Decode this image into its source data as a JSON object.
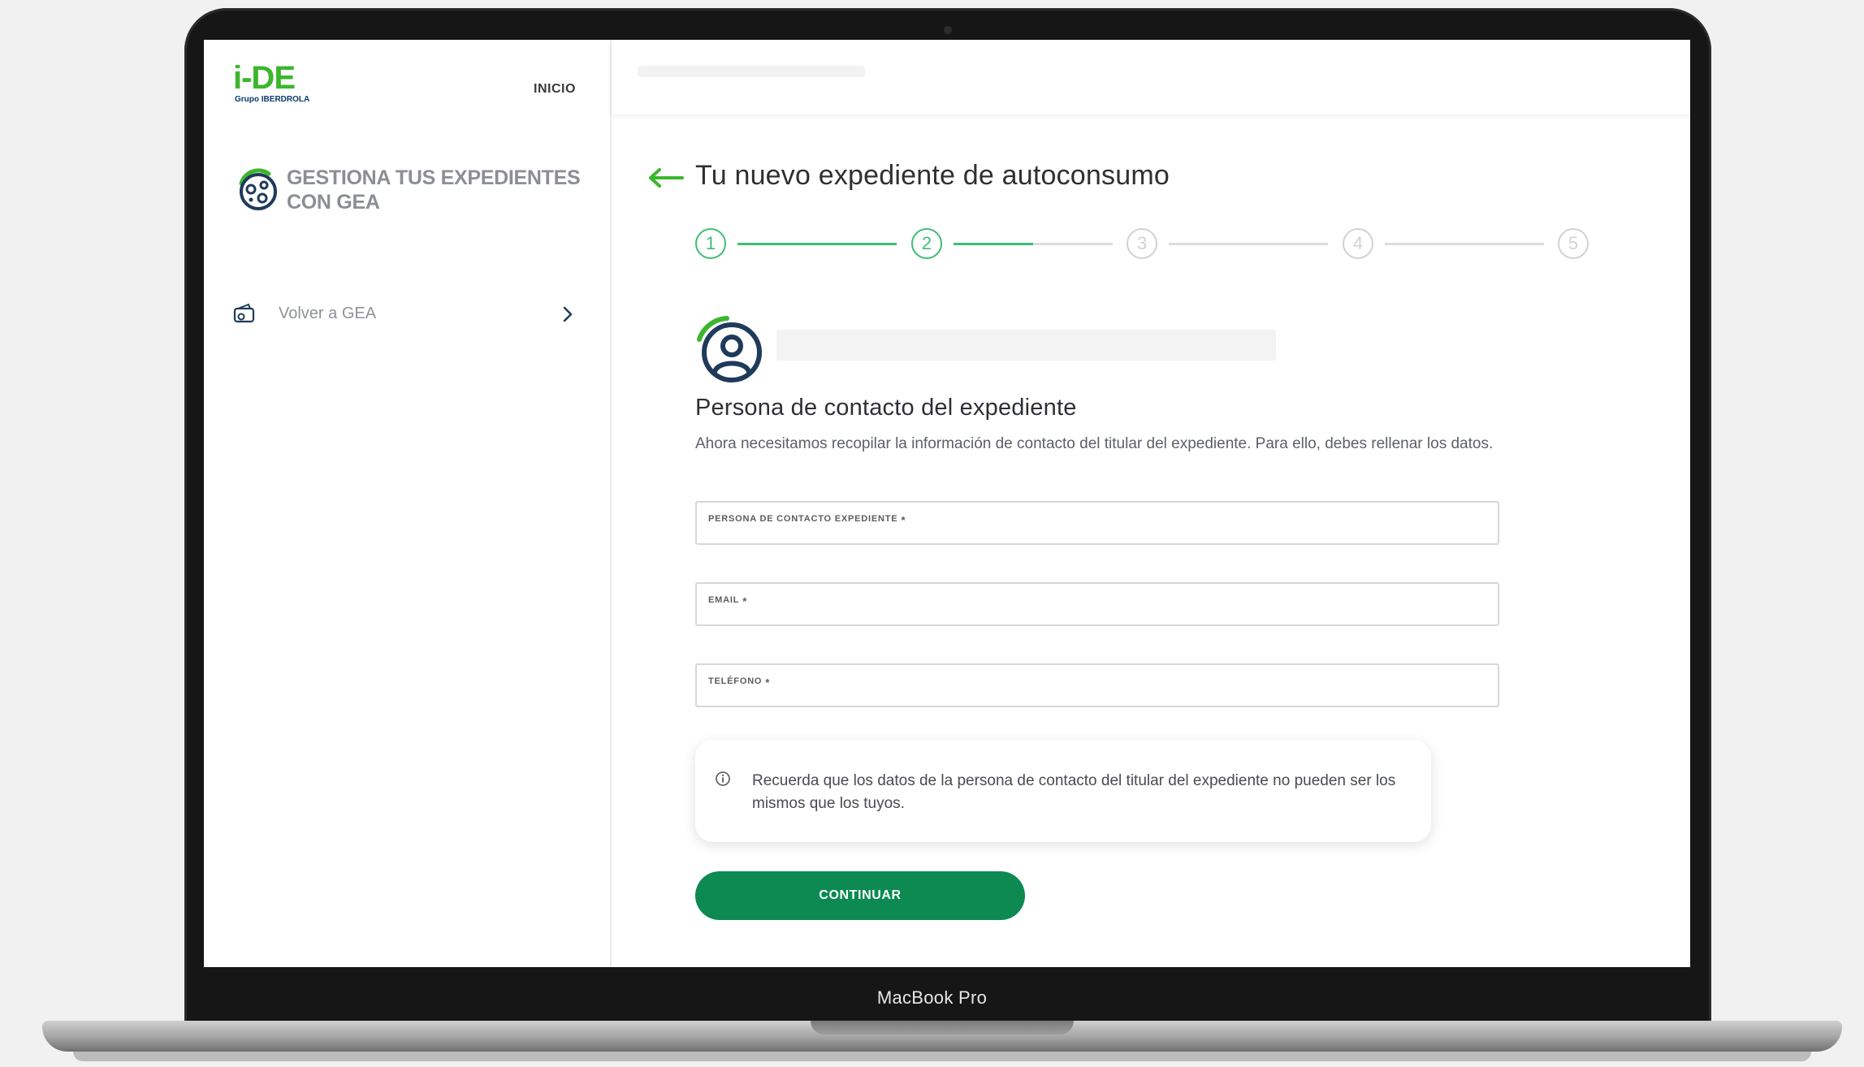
{
  "device": {
    "label": "MacBook Pro"
  },
  "sidebar": {
    "logo": {
      "text": "i-DE",
      "sub": "Grupo IBERDROLA"
    },
    "nav_home": "INICIO",
    "gea_title": "GESTIONA TUS EXPEDIENTES CON GEA",
    "back_link": "Volver a GEA"
  },
  "main": {
    "title": "Tu nuevo expediente de autoconsumo",
    "stepper": {
      "steps": [
        "1",
        "2",
        "3",
        "4",
        "5"
      ],
      "current_step": 2,
      "progress_within_step_2": 0.5
    },
    "section": {
      "title": "Persona de contacto del expediente",
      "description": "Ahora necesitamos recopilar la información de contacto del titular del expediente. Para ello, debes rellenar los datos."
    },
    "fields": [
      {
        "label": "Persona de contacto expediente",
        "required_mark": "*",
        "value": ""
      },
      {
        "label": "Email",
        "required_mark": "*",
        "value": ""
      },
      {
        "label": "Teléfono",
        "required_mark": "*",
        "value": ""
      }
    ],
    "notice": "Recuerda que los datos de la persona de contacto del titular del expediente no pueden ser los mismos que los tuyos.",
    "continue_label": "CONTINUAR"
  },
  "colors": {
    "brand_green": "#3cb62d",
    "step_green": "#3fbd72",
    "button_green": "#0c8a52",
    "navy": "#1f3a5a"
  },
  "icons": [
    "back-arrow-icon",
    "gea-icon",
    "wallet-icon",
    "chevron-right-icon",
    "user-avatar-icon",
    "info-icon"
  ]
}
